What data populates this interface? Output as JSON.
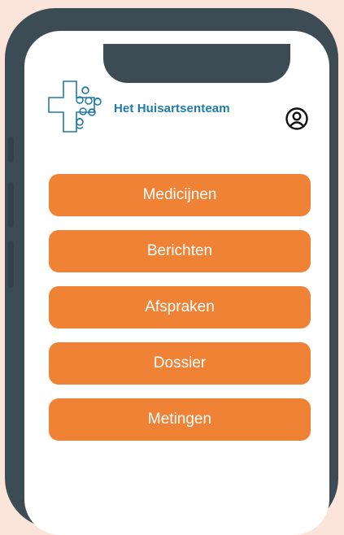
{
  "app": {
    "logo_text": "Het Huisartsenteam"
  },
  "header": {
    "profile_icon": "user-circle-icon"
  },
  "menu": {
    "items": [
      {
        "label": "Medicijnen"
      },
      {
        "label": "Berichten"
      },
      {
        "label": "Afspraken"
      },
      {
        "label": "Dossier"
      },
      {
        "label": "Metingen"
      }
    ]
  },
  "colors": {
    "background": "#fbe4da",
    "phone_frame": "#3d4b55",
    "button": "#f08235",
    "brand_blue": "#1f7aa8"
  }
}
